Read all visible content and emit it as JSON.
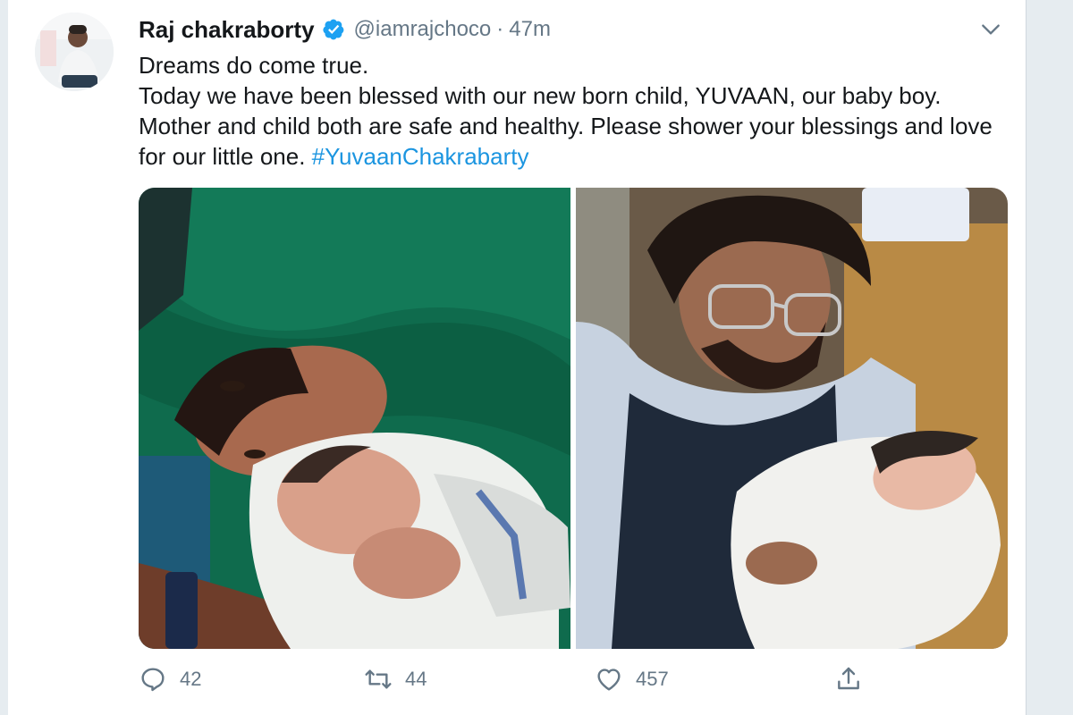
{
  "tweet": {
    "display_name": "Raj chakraborty",
    "handle": "@iamrajchoco",
    "separator": "·",
    "time": "47m",
    "text_lines": [
      "Dreams do come true.",
      "Today we have been blessed with our new born child, YUVAAN, our baby boy. Mother and child both are safe and healthy. Please shower your blessings and love for our little one. "
    ],
    "hashtag": "#YuvaanChakrabarty",
    "media": [
      "mother-with-newborn-photo",
      "father-holding-newborn-photo"
    ]
  },
  "actions": {
    "reply_count": "42",
    "retweet_count": "44",
    "like_count": "457"
  },
  "colors": {
    "accent": "#1b95e0",
    "verified": "#1da1f2",
    "muted": "#657786",
    "text": "#14171a"
  },
  "icons": [
    "verified-badge-icon",
    "chevron-down-icon",
    "reply-icon",
    "retweet-icon",
    "like-icon",
    "share-icon"
  ]
}
